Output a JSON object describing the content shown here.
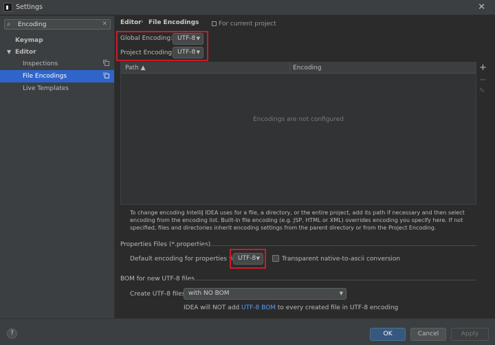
{
  "window": {
    "title": "Settings"
  },
  "search": {
    "value": "Encoding"
  },
  "sidebar": {
    "items": [
      {
        "label": "Keymap"
      },
      {
        "label": "Editor"
      },
      {
        "label": "Inspections"
      },
      {
        "label": "File Encodings"
      },
      {
        "label": "Live Templates"
      }
    ]
  },
  "breadcrumb": {
    "parent": "Editor",
    "current": "File Encodings",
    "scope": "For current project"
  },
  "encodings": {
    "global_label": "Global Encoding:",
    "global_value": "UTF-8",
    "project_label": "Project Encoding:",
    "project_value": "UTF-8"
  },
  "table": {
    "col_path": "Path",
    "col_encoding": "Encoding",
    "empty_text": "Encodings are not configured"
  },
  "help_text": "To change encoding IntelliJ IDEA uses for a file, a directory, or the entire project, add its path if necessary and then select encoding from the encoding list. Built-in file encoding (e.g. JSP, HTML or XML) overrides encoding you specify here. If not specified, files and directories inherit encoding settings from the parent directory or from the Project Encoding.",
  "properties": {
    "section_title": "Properties Files (*.properties)",
    "default_label": "Default encoding for properties files:",
    "default_value": "UTF-8",
    "native_label": "Transparent native-to-ascii conversion",
    "native_checked": false
  },
  "bom": {
    "section_title": "BOM for new UTF-8 files",
    "create_label": "Create UTF-8 files:",
    "create_value": "with NO BOM",
    "note_prefix": "IDEA will NOT add",
    "note_link": "UTF-8 BOM",
    "note_suffix": "to every created file in UTF-8 encoding"
  },
  "footer": {
    "help": "?",
    "ok": "OK",
    "cancel": "Cancel",
    "apply": "Apply"
  },
  "colors": {
    "selection": "#2f65ca",
    "highlight_box": "#cc1d26",
    "ok_button": "#365880",
    "link": "#589df6"
  }
}
